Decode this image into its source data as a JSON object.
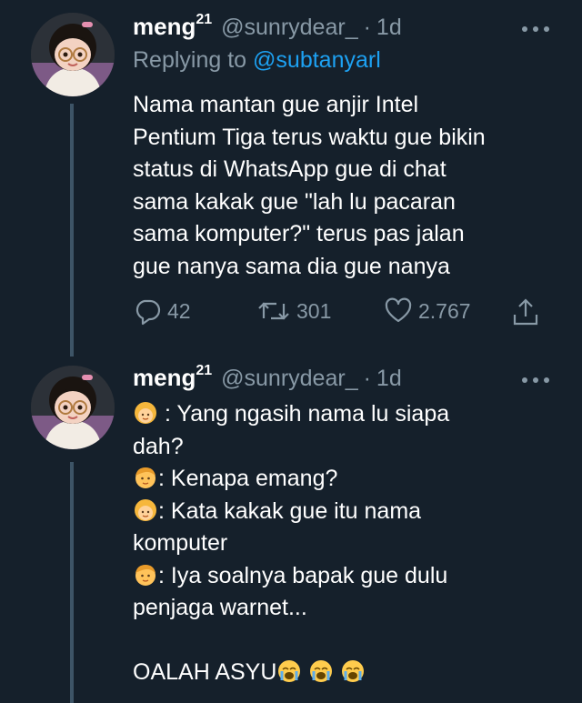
{
  "tweets": [
    {
      "author": {
        "name": "meng",
        "sup": "21",
        "handle": "@sunrydear_",
        "time": "1d"
      },
      "replying_to": {
        "prefix": "Replying to ",
        "mention": "@subtanyarl"
      },
      "lines": [
        "Nama mantan gue anjir Intel",
        "Pentium Tiga terus waktu gue bikin",
        "status di WhatsApp gue di chat",
        "sama kakak gue \"lah lu pacaran",
        "sama komputer?\" terus pas jalan",
        "gue nanya sama dia gue nanya"
      ],
      "actions": {
        "reply": "42",
        "retweet": "301",
        "like": "2.767"
      }
    },
    {
      "author": {
        "name": "meng",
        "sup": "21",
        "handle": "@sunrydear_",
        "time": "1d"
      },
      "lines": [
        ": Yang ngasih nama lu siapa",
        "dah?",
        ": Kenapa emang?",
        ": Kata kakak gue itu nama",
        "komputer",
        ": Iya soalnya bapak gue dulu",
        "penjaga warnet...",
        "",
        "OALAH ASYU"
      ]
    }
  ],
  "separator_dot": "·",
  "colors": {
    "background": "#15202b",
    "text": "#ffffff",
    "muted": "#8899a6",
    "link": "#1da1f2"
  },
  "icons": [
    "reply-icon",
    "retweet-icon",
    "like-icon",
    "share-icon",
    "more-icon",
    "woman-emoji",
    "boy-emoji",
    "crying-emoji"
  ]
}
